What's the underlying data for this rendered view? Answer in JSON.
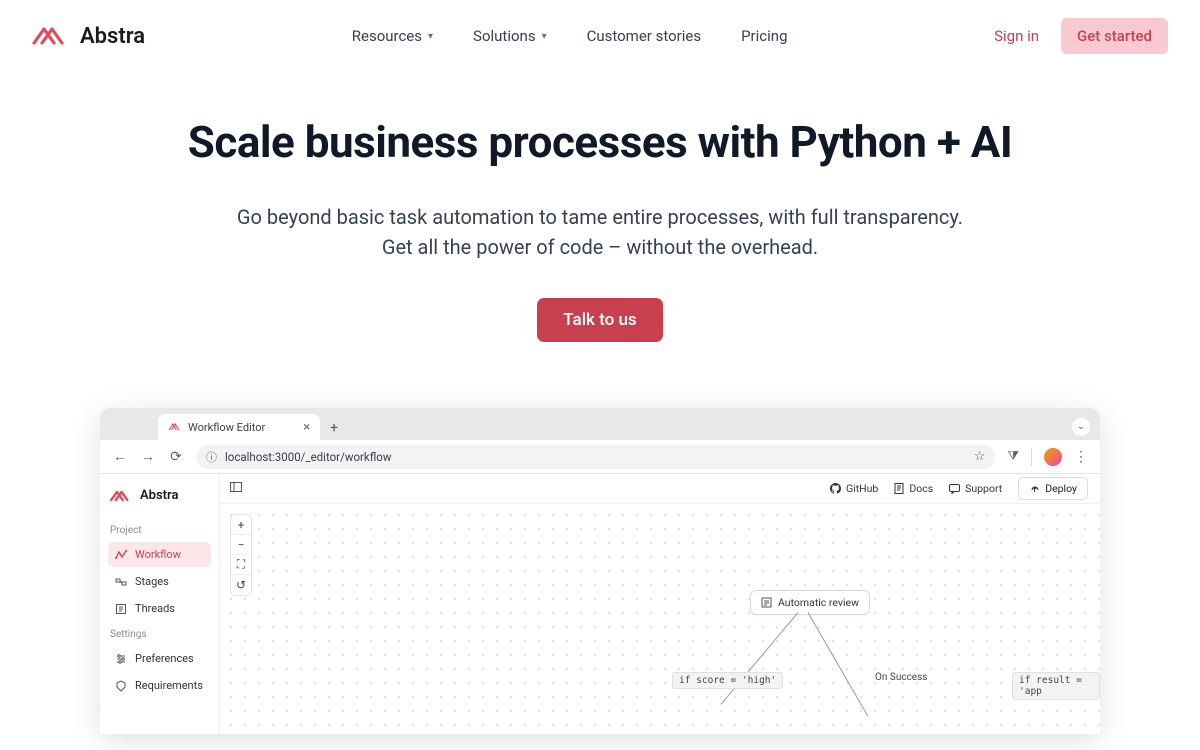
{
  "nav": {
    "brand": "Abstra",
    "links": [
      {
        "label": "Resources",
        "hasDropdown": true
      },
      {
        "label": "Solutions",
        "hasDropdown": true
      },
      {
        "label": "Customer stories",
        "hasDropdown": false
      },
      {
        "label": "Pricing",
        "hasDropdown": false
      }
    ],
    "signin": "Sign in",
    "getstarted": "Get started"
  },
  "hero": {
    "title": "Scale business processes with Python + AI",
    "subtitle": "Go beyond basic task automation to tame entire processes, with full transparency. Get all the power of code – without the overhead.",
    "cta": "Talk to us"
  },
  "browser": {
    "tabTitle": "Workflow Editor",
    "url": "localhost:3000/_editor/workflow"
  },
  "app": {
    "brand": "Abstra",
    "sections": {
      "project": {
        "label": "Project",
        "items": [
          {
            "label": "Workflow",
            "active": true,
            "icon": "workflow"
          },
          {
            "label": "Stages",
            "active": false,
            "icon": "stages"
          },
          {
            "label": "Threads",
            "active": false,
            "icon": "threads"
          }
        ]
      },
      "settings": {
        "label": "Settings",
        "items": [
          {
            "label": "Preferences",
            "active": false,
            "icon": "prefs"
          },
          {
            "label": "Requirements",
            "active": false,
            "icon": "reqs"
          }
        ]
      }
    },
    "topbar": {
      "github": "GitHub",
      "docs": "Docs",
      "support": "Support",
      "deploy": "Deploy"
    },
    "canvas": {
      "node1": "Automatic review",
      "edge1": "if score = 'high'",
      "edge2": "On Success",
      "edge3": "if result = 'app"
    }
  }
}
